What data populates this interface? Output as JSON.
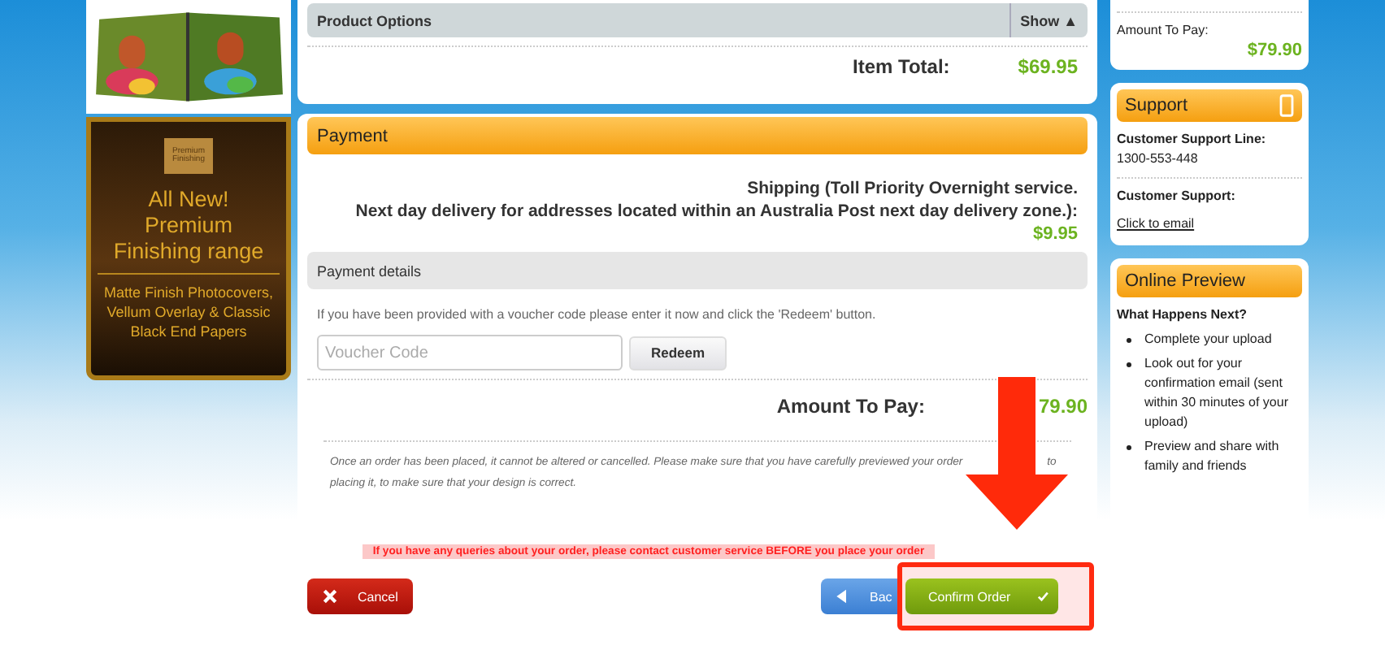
{
  "promo": {
    "badge": "Premium Finishing",
    "headline": "All New! Premium Finishing range",
    "subtext": "Matte Finish Photocovers, Vellum Overlay & Classic Black End Papers"
  },
  "order": {
    "product_options": {
      "label": "Product Options",
      "toggle": "Show ▲"
    },
    "item_total": {
      "label": "Item Total:",
      "value": "$69.95"
    }
  },
  "payment": {
    "title": "Payment",
    "shipping_line1": "Shipping (Toll Priority Overnight service.",
    "shipping_line2": "Next day delivery for addresses located within an Australia Post next day delivery zone.):",
    "shipping_price": "$9.95",
    "details_title": "Payment details",
    "voucher_hint": "If you have been provided with a voucher code please enter it now and click the 'Redeem' button.",
    "voucher": {
      "placeholder": "Voucher Code"
    },
    "redeem": "Redeem",
    "amount_label": "Amount To Pay:",
    "amount_value": "79.90"
  },
  "notice": {
    "text_before": "Once an order has been placed, it cannot be altered or cancelled. Please make sure that you have carefully previewed your order",
    "text_after": "to",
    "line2": "placing it, to make sure that your design is correct."
  },
  "warning": "If you have any queries about your order, please contact customer service BEFORE you place your order",
  "buttons": {
    "cancel": "Cancel",
    "back": "Bac",
    "confirm": "Confirm Order"
  },
  "summary": {
    "label": "Amount To Pay:",
    "value": "$79.90"
  },
  "support": {
    "title": "Support",
    "line_label": "Customer Support Line:",
    "phone": "1300-553-448",
    "email_label": "Customer Support:",
    "email_link": "Click to email"
  },
  "preview": {
    "title": "Online Preview",
    "heading": "What Happens Next?",
    "steps": [
      "Complete your upload",
      "Look out for your confirmation email (sent within 30 minutes of your upload)",
      "Preview and share with family and friends"
    ]
  }
}
